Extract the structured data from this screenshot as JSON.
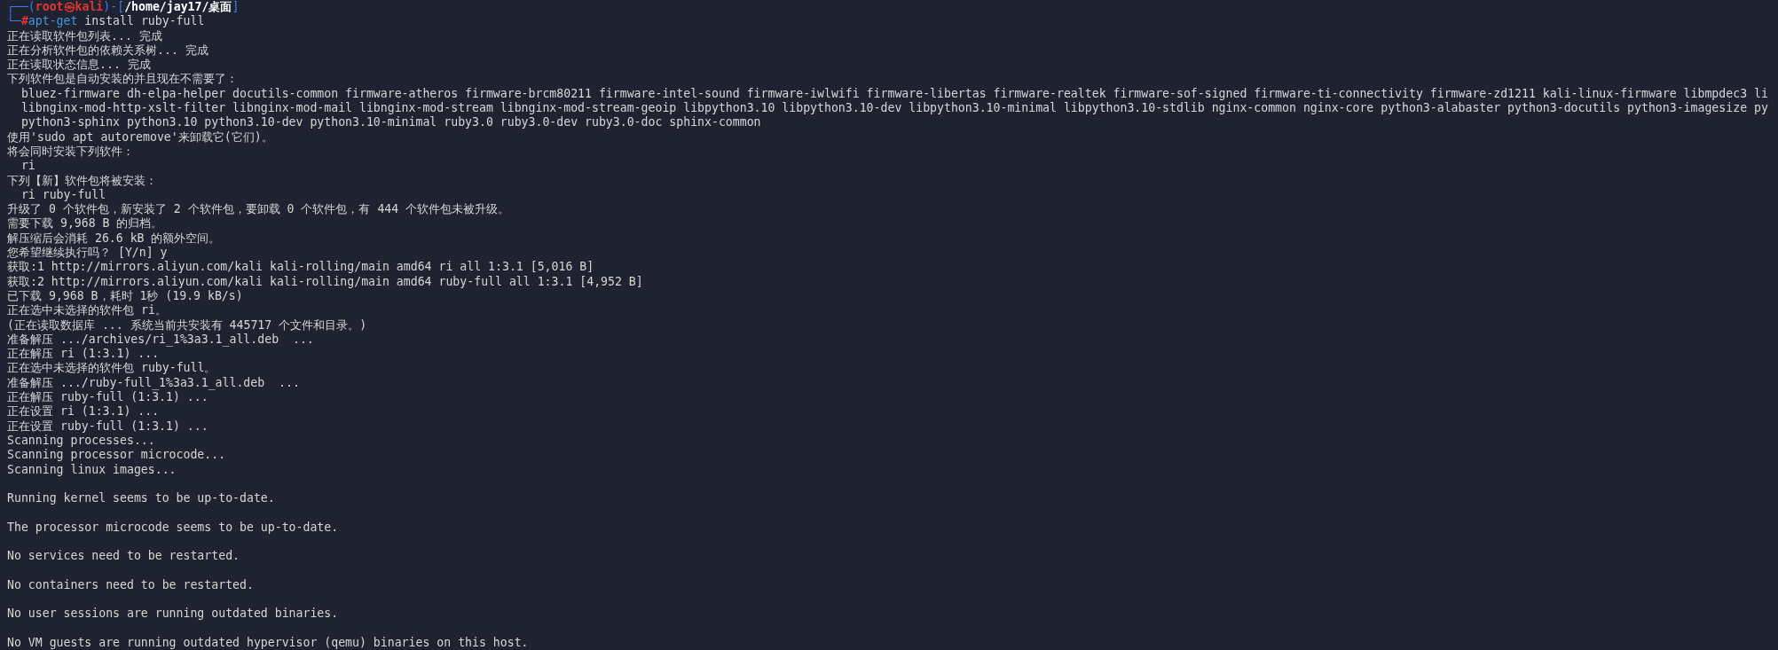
{
  "prompt": {
    "open": "┌──(",
    "user_host": "root㉿kali",
    "mid": ")-[",
    "path": "/home/jay17/桌面",
    "close": "]"
  },
  "command": {
    "lead": "└─",
    "symbol": "#",
    "program": "apt-get",
    "args": " install ruby-full"
  },
  "output_blocks": [
    [
      "正在读取软件包列表... 完成",
      "正在分析软件包的依赖关系树... 完成",
      "正在读取状态信息... 完成",
      "下列软件包是自动安装的并且现在不需要了：",
      "  bluez-firmware dh-elpa-helper docutils-common firmware-atheros firmware-brcm80211 firmware-intel-sound firmware-iwlwifi firmware-libertas firmware-realtek firmware-sof-signed firmware-ti-connectivity firmware-zd1211 kali-linux-firmware libmpdec3 li",
      "  libnginx-mod-http-xslt-filter libnginx-mod-mail libnginx-mod-stream libnginx-mod-stream-geoip libpython3.10 libpython3.10-dev libpython3.10-minimal libpython3.10-stdlib nginx-common nginx-core python3-alabaster python3-docutils python3-imagesize py",
      "  python3-sphinx python3.10 python3.10-dev python3.10-minimal ruby3.0 ruby3.0-dev ruby3.0-doc sphinx-common",
      "使用'sudo apt autoremove'来卸载它(它们)。",
      "将会同时安装下列软件：",
      "  ri",
      "下列【新】软件包将被安装：",
      "  ri ruby-full",
      "升级了 0 个软件包，新安装了 2 个软件包，要卸载 0 个软件包，有 444 个软件包未被升级。",
      "需要下载 9,968 B 的归档。",
      "解压缩后会消耗 26.6 kB 的额外空间。",
      "您希望继续执行吗？ [Y/n] y",
      "获取:1 http://mirrors.aliyun.com/kali kali-rolling/main amd64 ri all 1:3.1 [5,016 B]",
      "获取:2 http://mirrors.aliyun.com/kali kali-rolling/main amd64 ruby-full all 1:3.1 [4,952 B]",
      "已下载 9,968 B，耗时 1秒 (19.9 kB/s)",
      "正在选中未选择的软件包 ri。",
      "(正在读取数据库 ... 系统当前共安装有 445717 个文件和目录。)",
      "准备解压 .../archives/ri_1%3a3.1_all.deb  ...",
      "正在解压 ri (1:3.1) ...",
      "正在选中未选择的软件包 ruby-full。",
      "准备解压 .../ruby-full_1%3a3.1_all.deb  ...",
      "正在解压 ruby-full (1:3.1) ...",
      "正在设置 ri (1:3.1) ...",
      "正在设置 ruby-full (1:3.1) ...",
      "Scanning processes...",
      "Scanning processor microcode...",
      "Scanning linux images..."
    ],
    [
      "Running kernel seems to be up-to-date."
    ],
    [
      "The processor microcode seems to be up-to-date."
    ],
    [
      "No services need to be restarted."
    ],
    [
      "No containers need to be restarted."
    ],
    [
      "No user sessions are running outdated binaries."
    ],
    [
      "No VM guests are running outdated hypervisor (qemu) binaries on this host."
    ]
  ]
}
